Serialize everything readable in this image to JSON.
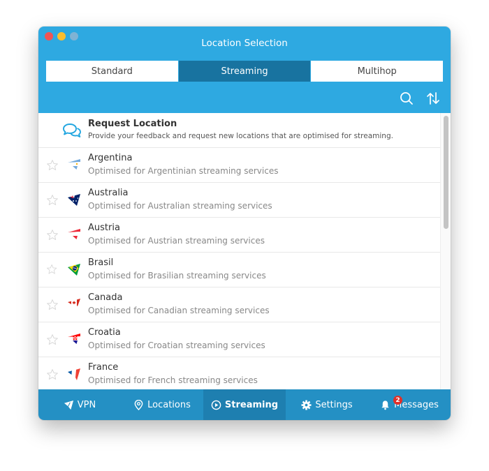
{
  "window": {
    "title": "Location Selection"
  },
  "tabs": [
    {
      "label": "Standard",
      "active": false
    },
    {
      "label": "Streaming",
      "active": true
    },
    {
      "label": "Multihop",
      "active": false
    }
  ],
  "toolbar": {
    "search_icon": "search-icon",
    "sort_icon": "sort-icon"
  },
  "request": {
    "title": "Request Location",
    "description": "Provide your feedback and request new locations that are optimised for streaming.",
    "icon": "chat-bubbles-icon"
  },
  "locations": [
    {
      "name": "Argentina",
      "description": "Optimised for Argentinian streaming services",
      "flag": "argentina",
      "favorite": false
    },
    {
      "name": "Australia",
      "description": "Optimised for Australian streaming services",
      "flag": "australia",
      "favorite": false
    },
    {
      "name": "Austria",
      "description": "Optimised for Austrian streaming services",
      "flag": "austria",
      "favorite": false
    },
    {
      "name": "Brasil",
      "description": "Optimised for Brasilian streaming services",
      "flag": "brasil",
      "favorite": false
    },
    {
      "name": "Canada",
      "description": "Optimised for Canadian streaming services",
      "flag": "canada",
      "favorite": false
    },
    {
      "name": "Croatia",
      "description": "Optimised for Croatian streaming services",
      "flag": "croatia",
      "favorite": false
    },
    {
      "name": "France",
      "description": "Optimised for French streaming services",
      "flag": "france",
      "favorite": false
    }
  ],
  "bottom_nav": [
    {
      "label": "VPN",
      "icon": "vpn-icon",
      "active": false
    },
    {
      "label": "Locations",
      "icon": "location-pin-icon",
      "active": false
    },
    {
      "label": "Streaming",
      "icon": "play-circle-icon",
      "active": true
    },
    {
      "label": "Settings",
      "icon": "gear-icon",
      "active": false
    },
    {
      "label": "Messages",
      "icon": "bell-icon",
      "active": false,
      "badge": "2"
    }
  ],
  "colors": {
    "accent": "#2ea9e1",
    "active_tab": "#1873a0",
    "bottom_bar": "#2490c4",
    "badge": "#e0312a"
  }
}
